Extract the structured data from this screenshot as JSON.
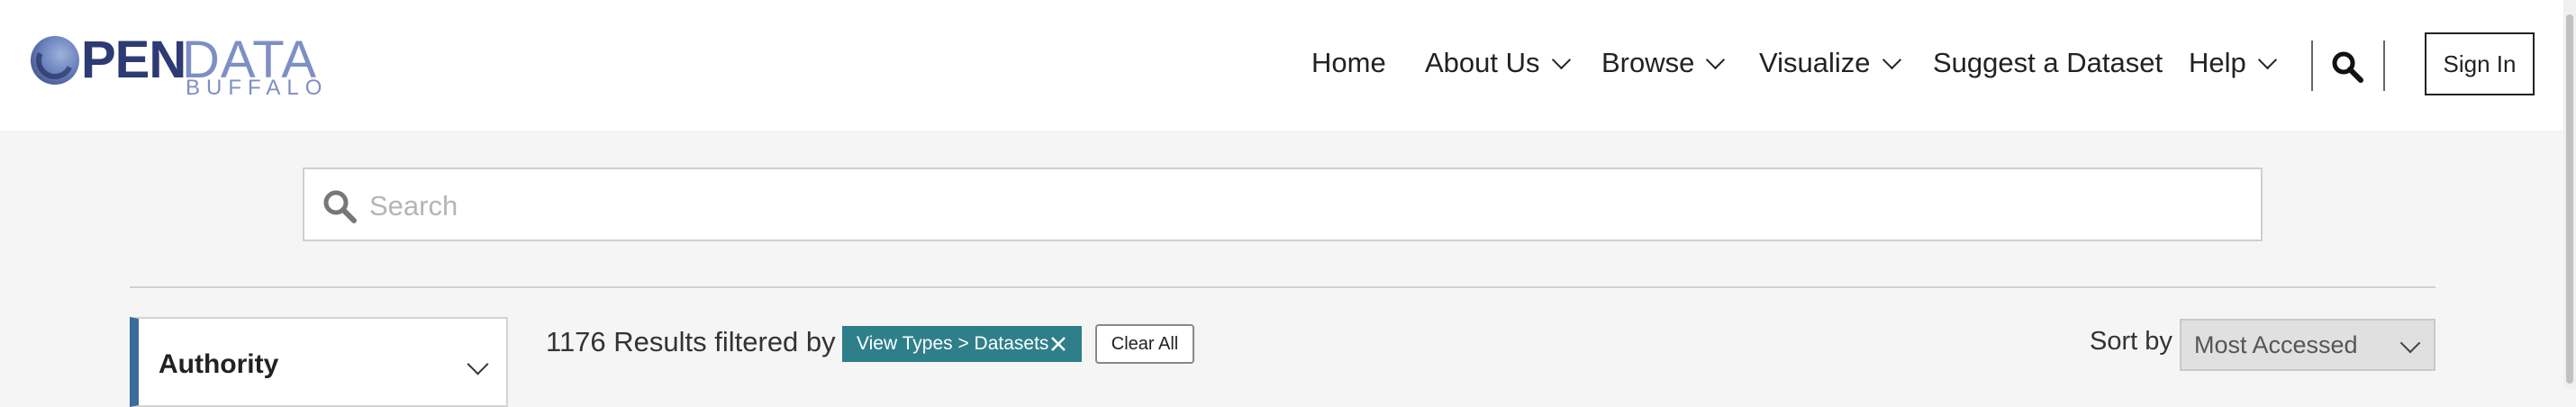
{
  "header": {
    "logo": {
      "word1": "OPEN",
      "word1_tail": "PEN",
      "word2": "DATA",
      "city": "BUFFALO"
    },
    "nav": [
      {
        "label": "Home",
        "dropdown": false
      },
      {
        "label": "About Us",
        "dropdown": true
      },
      {
        "label": "Browse",
        "dropdown": true
      },
      {
        "label": "Visualize",
        "dropdown": true
      },
      {
        "label": "Suggest a Dataset",
        "dropdown": false
      },
      {
        "label": "Help",
        "dropdown": true
      }
    ],
    "search_icon": "search-icon",
    "sign_in_label": "Sign In"
  },
  "search": {
    "placeholder": "Search",
    "value": ""
  },
  "sidebar": {
    "filter_title": "Authority"
  },
  "results": {
    "count_text": "1176 Results filtered by",
    "active_filter": "View Types > Datasets",
    "clear_all_label": "Clear All"
  },
  "sort": {
    "label": "Sort by",
    "selected": "Most Accessed"
  },
  "colors": {
    "brand_dark": "#2d3a73",
    "brand_light": "#7d8fc4",
    "chip": "#2f7f8a",
    "filter_accent": "#3b6b9a"
  }
}
